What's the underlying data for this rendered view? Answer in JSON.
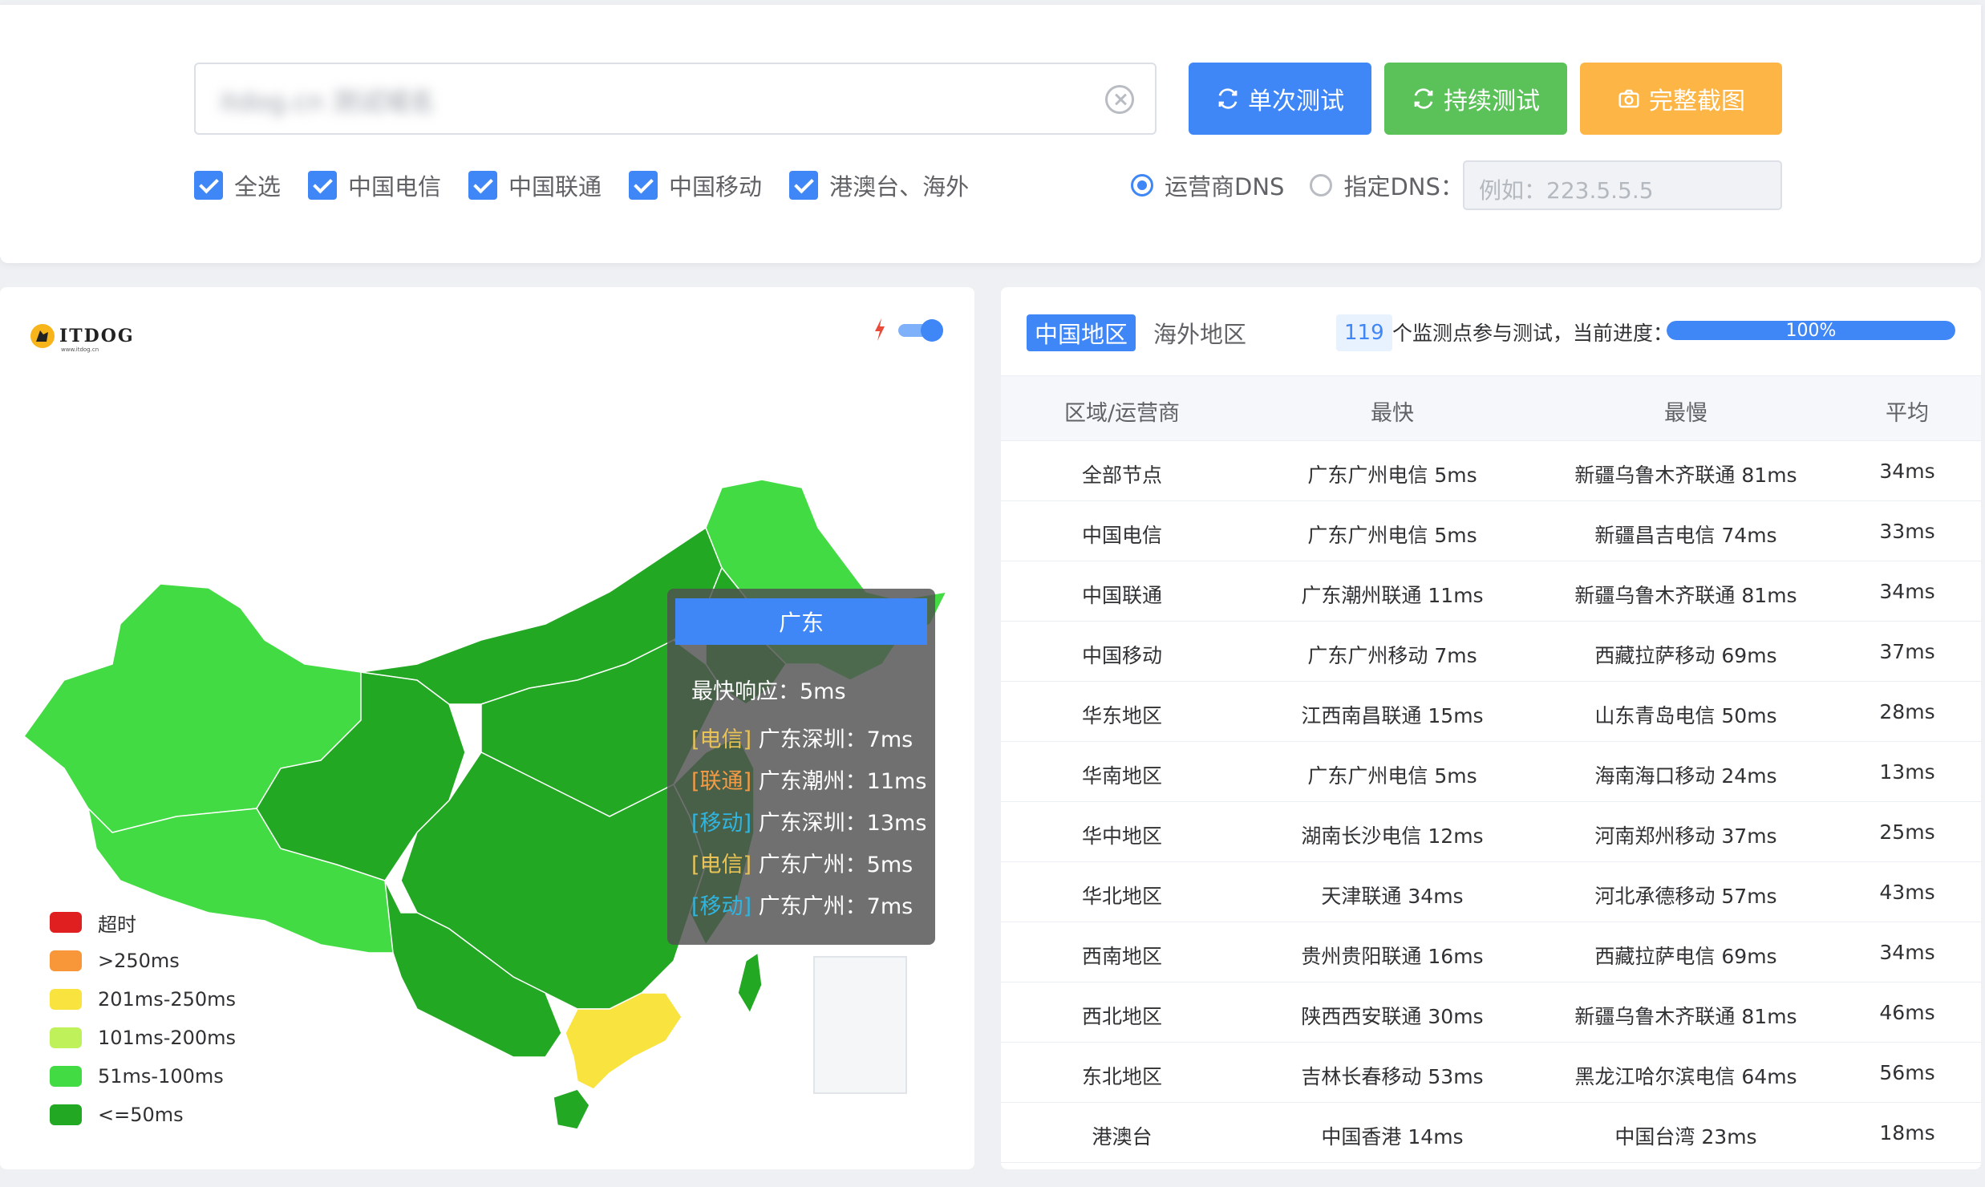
{
  "toolbar": {
    "url_value": "itdog.cn 测试域名",
    "btn_single": "单次测试",
    "btn_continuous": "持续测试",
    "btn_screenshot": "完整截图"
  },
  "filters": {
    "checkboxes": [
      "全选",
      "中国电信",
      "中国联通",
      "中国移动",
      "港澳台、海外"
    ],
    "dns_options": [
      "运营商DNS",
      "指定DNS："
    ],
    "dns_placeholder": "例如：223.5.5.5"
  },
  "logo": {
    "text": "ITDOG",
    "sub": "www.itdog.cn"
  },
  "legend": [
    {
      "label": "超时",
      "color": "#e02020"
    },
    {
      "label": ">250ms",
      "color": "#f7973a"
    },
    {
      "label": "201ms-250ms",
      "color": "#f8e33f"
    },
    {
      "label": "101ms-200ms",
      "color": "#bff15a"
    },
    {
      "label": "51ms-100ms",
      "color": "#43db43"
    },
    {
      "label": "<=50ms",
      "color": "#23a823"
    }
  ],
  "tooltip": {
    "title": "广东",
    "fastest": "最快响应：5ms",
    "rows": [
      {
        "isp": "[电信]",
        "text": " 广东深圳：7ms"
      },
      {
        "isp": "[联通]",
        "text": " 广东潮州：11ms"
      },
      {
        "isp": "[移动]",
        "text": " 广东深圳：13ms"
      },
      {
        "isp": "[电信]",
        "text": " 广东广州：5ms"
      },
      {
        "isp": "[移动]",
        "text": " 广东广州：7ms"
      }
    ]
  },
  "stats": {
    "tabs": [
      "中国地区",
      "海外地区"
    ],
    "node_count": "119",
    "node_text": "个监测点参与测试，当前进度：",
    "progress_label": "100%",
    "progress": 1.0,
    "headers": [
      "区域/运营商",
      "最快",
      "最慢",
      "平均"
    ],
    "rows": [
      [
        "全部节点",
        "广东广州电信 5ms",
        "新疆乌鲁木齐联通 81ms",
        "34ms"
      ],
      [
        "中国电信",
        "广东广州电信 5ms",
        "新疆昌吉电信 74ms",
        "33ms"
      ],
      [
        "中国联通",
        "广东潮州联通 11ms",
        "新疆乌鲁木齐联通 81ms",
        "34ms"
      ],
      [
        "中国移动",
        "广东广州移动 7ms",
        "西藏拉萨移动 69ms",
        "37ms"
      ],
      [
        "华东地区",
        "江西南昌联通 15ms",
        "山东青岛电信 50ms",
        "28ms"
      ],
      [
        "华南地区",
        "广东广州电信 5ms",
        "海南海口移动 24ms",
        "13ms"
      ],
      [
        "华中地区",
        "湖南长沙电信 12ms",
        "河南郑州移动 37ms",
        "25ms"
      ],
      [
        "华北地区",
        "天津联通 34ms",
        "河北承德移动 57ms",
        "43ms"
      ],
      [
        "西南地区",
        "贵州贵阳联通 16ms",
        "西藏拉萨电信 69ms",
        "34ms"
      ],
      [
        "西北地区",
        "陕西西安联通 30ms",
        "新疆乌鲁木齐联通 81ms",
        "46ms"
      ],
      [
        "东北地区",
        "吉林长春移动 53ms",
        "黑龙江哈尔滨电信 64ms",
        "56ms"
      ],
      [
        "港澳台",
        "中国香港 14ms",
        "中国台湾 23ms",
        "18ms"
      ]
    ]
  }
}
